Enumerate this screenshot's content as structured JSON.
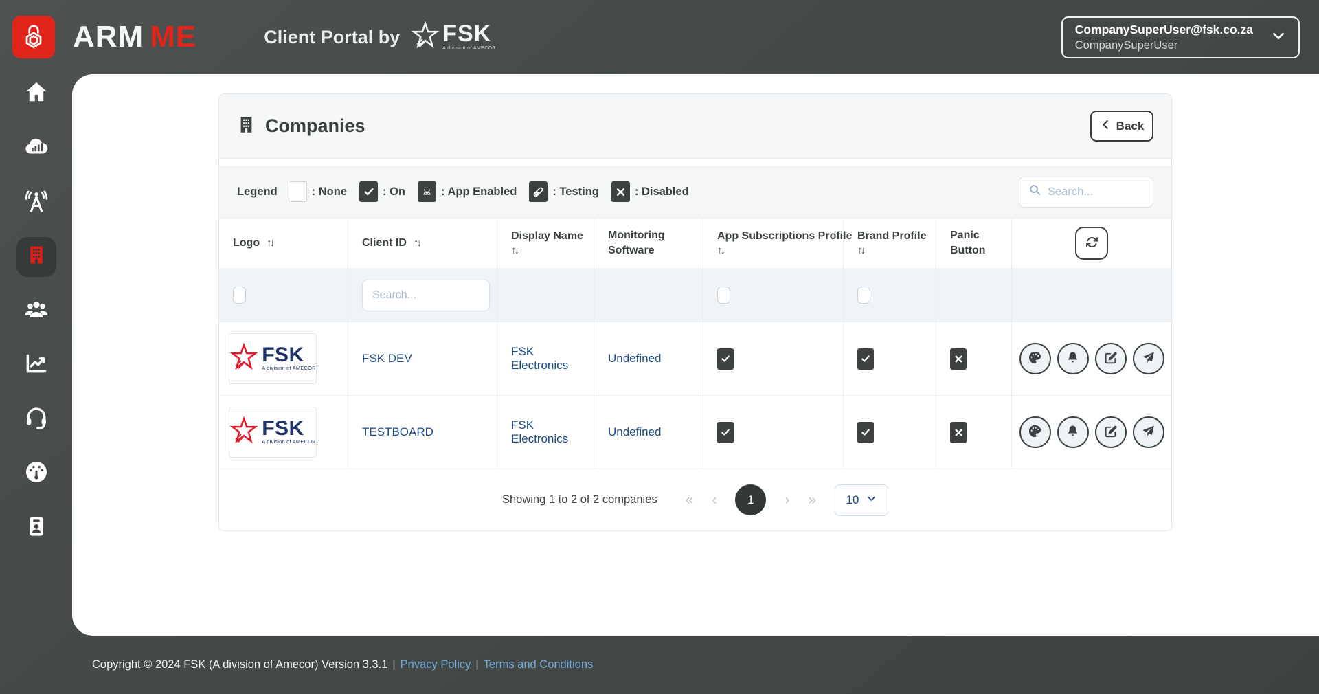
{
  "colors": {
    "accent_red": "#e1251b",
    "dark_slate": "#3d4241",
    "link_blue": "#1d4c85",
    "footer_link_blue": "#74a9db",
    "page_background": "#454a49"
  },
  "header": {
    "brand": {
      "arm": "ARM",
      "me": "ME",
      "fsk": "FSK",
      "fsk_tagline": "A division of AMECOR"
    },
    "portal_title": "Client Portal by",
    "user": {
      "email": "CompanySuperUser@fsk.co.za",
      "name": "CompanySuperUser"
    }
  },
  "sidebar": {
    "items": [
      {
        "icon": "home-icon",
        "active": false
      },
      {
        "icon": "cloud-stats-icon",
        "active": false
      },
      {
        "icon": "broadcast-tower-icon",
        "active": false
      },
      {
        "icon": "companies-building-icon",
        "active": true
      },
      {
        "icon": "users-icon",
        "active": false
      },
      {
        "icon": "chart-line-icon",
        "active": false
      },
      {
        "icon": "headset-icon",
        "active": false
      },
      {
        "icon": "gauge-icon",
        "active": false
      },
      {
        "icon": "id-card-icon",
        "active": false
      }
    ]
  },
  "panel": {
    "title": "Companies",
    "back_label": "Back",
    "legend": {
      "label": "Legend",
      "items": [
        {
          "icon": "none-box",
          "label": ": None"
        },
        {
          "icon": "check-box",
          "label": ": On"
        },
        {
          "icon": "android-box",
          "label": ": App Enabled"
        },
        {
          "icon": "vial-box",
          "label": ": Testing"
        },
        {
          "icon": "x-box",
          "label": ": Disabled"
        }
      ]
    },
    "search_placeholder": "Search...",
    "table": {
      "columns": [
        {
          "label": "Logo",
          "sortable": true
        },
        {
          "label": "Client ID",
          "sortable": true
        },
        {
          "label": "Display Name",
          "sortable": true
        },
        {
          "label": "Monitoring Software",
          "sortable": false
        },
        {
          "label": "App Subscriptions Profile",
          "sortable": true
        },
        {
          "label": "Brand Profile",
          "sortable": true
        },
        {
          "label": "Panic Button",
          "sortable": false
        },
        {
          "label": "",
          "sortable": false
        }
      ],
      "filter": {
        "client_id_placeholder": "Search..."
      },
      "rows": [
        {
          "logo": "FSK logo",
          "client_id": "FSK DEV",
          "display_name": "FSK Electronics",
          "monitoring_software": "Undefined",
          "app_subscriptions_profile": "on",
          "brand_profile": "on",
          "panic_button": "disabled",
          "actions": [
            "brand-palette",
            "notifications-bell",
            "edit",
            "send"
          ]
        },
        {
          "logo": "FSK logo",
          "client_id": "TESTBOARD",
          "display_name": "FSK Electronics",
          "monitoring_software": "Undefined",
          "app_subscriptions_profile": "on",
          "brand_profile": "on",
          "panic_button": "disabled",
          "actions": [
            "brand-palette",
            "notifications-bell",
            "edit",
            "send"
          ]
        }
      ]
    },
    "pagination": {
      "summary": "Showing 1 to 2 of 2 companies",
      "current_page": "1",
      "page_size": "10"
    }
  },
  "icons": {
    "sort": "↑↓",
    "pg_first": "«",
    "pg_prev": "‹",
    "pg_next": "›",
    "pg_last": "»"
  },
  "footer": {
    "copyright": "Copyright © 2024 FSK (A division of Amecor) Version 3.3.1",
    "separator": "|",
    "links": [
      "Privacy Policy",
      "Terms and Conditions"
    ]
  }
}
